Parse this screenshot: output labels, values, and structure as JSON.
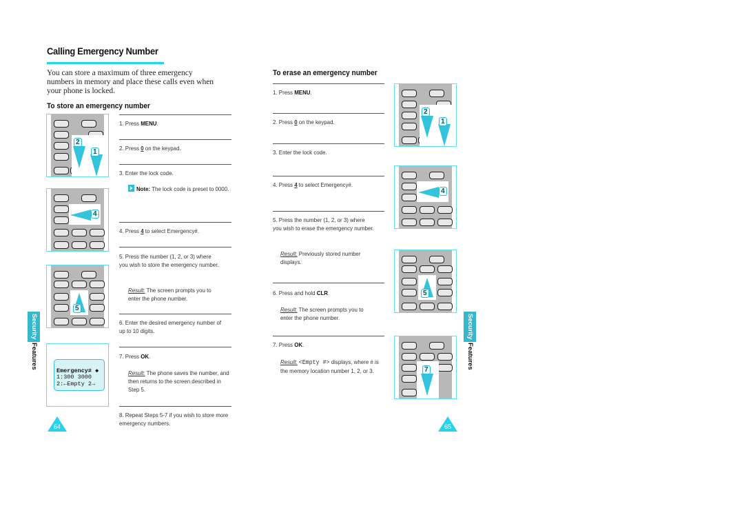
{
  "page": {
    "title": "Calling Emergency Number",
    "intro": "You can store a maximum of three emergency numbers in memory and place these calls even when your phone is locked.",
    "accent_color": "#20d8ee",
    "tab_color": "#36b7cc"
  },
  "store_section": {
    "heading": "To store an emergency number",
    "steps": [
      {
        "num": "1.",
        "pre": "Press ",
        "key": "MENU",
        "post": "."
      },
      {
        "num": "2.",
        "pre": "Press ",
        "key": "0",
        "post": " on the keypad."
      },
      {
        "num": "3.",
        "pre": "Enter the lock code.",
        "key": "",
        "post": ""
      },
      {
        "num": "4.",
        "pre": "Press ",
        "key": "4",
        "post": " to select Emergency#."
      },
      {
        "num": "5.",
        "pre": "Press the number (1, 2, or 3) where you wish to store the emergency number.",
        "key": "",
        "post": ""
      },
      {
        "num": "6.",
        "pre": "Enter the desired emergency number of up to 10 digits.",
        "key": "",
        "post": ""
      },
      {
        "num": "7.",
        "pre": "Press ",
        "key": "OK",
        "post": "."
      },
      {
        "num": "8.",
        "pre": "Repeat Steps 5-7 if you wish to store more emergency numbers.",
        "key": "",
        "post": ""
      }
    ],
    "note_label": "Note:",
    "note_text": " The lock code is preset to 0000.",
    "result_label": "Result:",
    "result_5": " The screen prompts you to enter the phone number.",
    "result_7": " The phone saves the number, and then returns to the screen described in Step 5.",
    "lcd": {
      "line0": "          ",
      "line1": "Emergency# ◆",
      "line2": "1:300 3000",
      "line3": "2:←Empty 2→"
    },
    "page_number": "64"
  },
  "erase_section": {
    "heading": "To erase an emergency number",
    "steps": [
      {
        "num": "1.",
        "pre": "Press ",
        "key": "MENU",
        "post": "."
      },
      {
        "num": "2.",
        "pre": "Press ",
        "key": "0",
        "post": " on the keypad."
      },
      {
        "num": "3.",
        "pre": "Enter the lock code.",
        "key": "",
        "post": ""
      },
      {
        "num": "4.",
        "pre": "Press ",
        "key": "4",
        "post": " to select Emergency#."
      },
      {
        "num": "5.",
        "pre": "Press the number (1, 2, or 3) where you wish to erase the emergency number.",
        "key": "",
        "post": ""
      },
      {
        "num": "6.",
        "pre": "Press and hold ",
        "key": "CLR",
        "post": "."
      },
      {
        "num": "7.",
        "pre": "Press ",
        "key": "OK",
        "post": "."
      }
    ],
    "result_label": "Result:",
    "result_5": " Previously stored number displays.",
    "result_6": " The screen prompts you to enter the phone number.",
    "result_7_code": "<Empty #>",
    "result_7": " displays, where # is the memory location number 1, 2, or 3.",
    "page_number": "65"
  },
  "side_tab": {
    "highlight": "Security",
    "rest": "Features"
  },
  "callouts": {
    "menu_pair": [
      "2",
      "1"
    ],
    "four": "4",
    "five": "5",
    "seven": "7"
  }
}
